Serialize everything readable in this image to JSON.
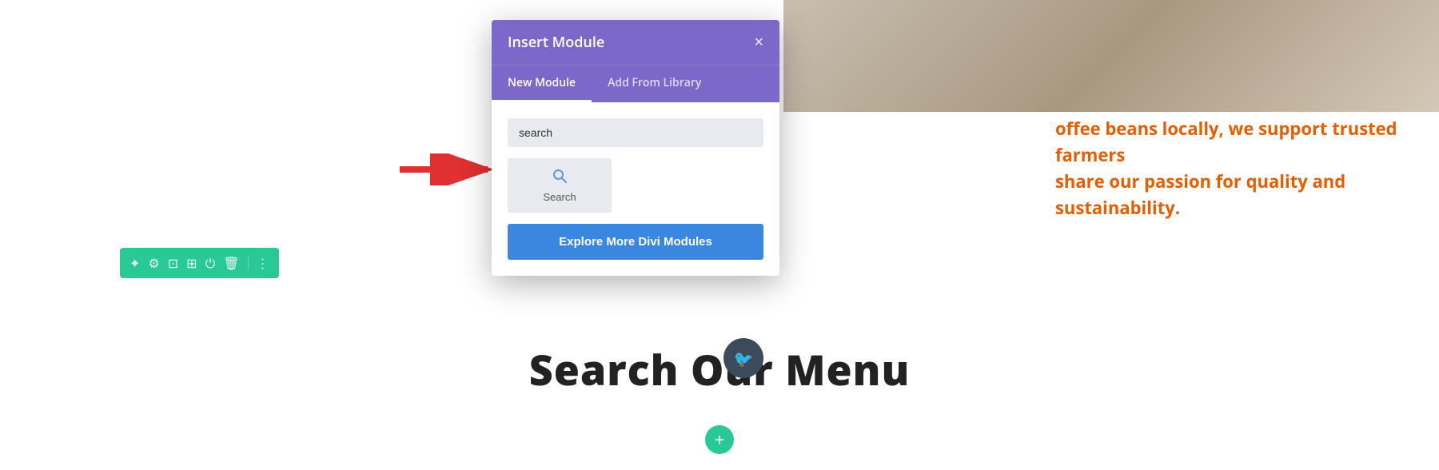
{
  "modal": {
    "title": "Insert Module",
    "close_label": "×",
    "tabs": [
      {
        "label": "New Module",
        "active": true
      },
      {
        "label": "Add From Library",
        "active": false
      }
    ],
    "search_placeholder": "search",
    "search_button_label": "Search",
    "explore_button_label": "Explore More Divi Modules"
  },
  "toolbar": {
    "icons": [
      "✦",
      "⚙",
      "⊡",
      "⊞",
      "⏻",
      "🗑",
      "⋮"
    ]
  },
  "page_content": {
    "orange_text_line1": "offee beans locally, we support trusted farmers",
    "orange_text_line2": "share our passion for quality and sustainability.",
    "heading": "Search Our Menu",
    "add_button_label": "+"
  },
  "colors": {
    "purple": "#7b68c8",
    "green": "#29c995",
    "blue": "#3a87e0",
    "orange": "#e85d00",
    "red_arrow": "#e03030"
  }
}
